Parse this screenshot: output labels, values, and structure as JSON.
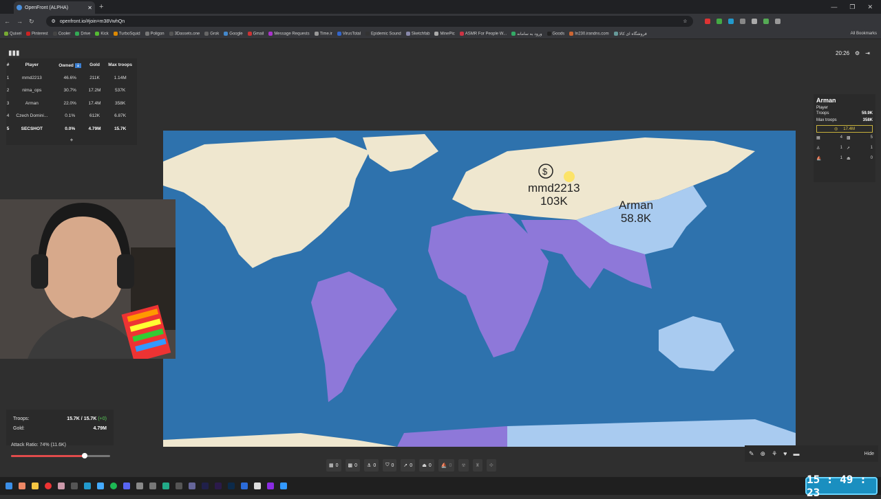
{
  "browser": {
    "tab_title": "OpenFront (ALPHA)",
    "url": "openfront.io/#join=m38VwhQn",
    "bookmarks": [
      "Quixel",
      "Pinterest",
      "Cooler",
      "Drive",
      "Kick",
      "TurboSquid",
      "Poligon",
      "3Dassets.one",
      "Grok",
      "Google",
      "Gmail",
      "Message Requests",
      "Time.ir",
      "VirusTotal",
      "Epidemic Sound",
      "Sketchfab",
      "MinePic",
      "ASMR For People W...",
      "ورود به سامانه",
      "Goods",
      "In230.irandns.com",
      "فروشگاه ای کالا"
    ],
    "all_bookmarks": "All Bookmarks"
  },
  "leaderboard": {
    "headers": [
      "#",
      "Player",
      "Owned",
      "Gold",
      "Max troops"
    ],
    "rows": [
      {
        "rank": "1",
        "player": "mmd2213",
        "owned": "46.6%",
        "gold": "211K",
        "max": "1.14M"
      },
      {
        "rank": "2",
        "player": "nima_ops",
        "owned": "30.7%",
        "gold": "17.2M",
        "max": "537K"
      },
      {
        "rank": "3",
        "player": "Arman",
        "owned": "22.0%",
        "gold": "17.4M",
        "max": "358K"
      },
      {
        "rank": "4",
        "player": "Czech Domini...",
        "owned": "0.1%",
        "gold": "612K",
        "max": "6.87K"
      },
      {
        "rank": "5",
        "player": "SECSHOT",
        "owned": "0.0%",
        "gold": "4.79M",
        "max": "15.7K"
      }
    ],
    "expand": "+"
  },
  "game_time": "20:26",
  "player_info": {
    "name": "Arman",
    "type": "Player",
    "troops_label": "Troops",
    "troops": "59.9K",
    "max_label": "Max troops",
    "max": "358K",
    "gold": "17.4M",
    "buildings": [
      {
        "icon": "city",
        "n": "4"
      },
      {
        "icon": "factory",
        "n": "5"
      },
      {
        "icon": "port",
        "n": "1"
      },
      {
        "icon": "missile",
        "n": "1"
      },
      {
        "icon": "warship",
        "n": "1"
      },
      {
        "icon": "silo",
        "n": "0"
      }
    ]
  },
  "map": {
    "labels": [
      {
        "name": "mmd2213",
        "troops": "103K"
      },
      {
        "name": "Arman",
        "troops": "58.8K"
      }
    ],
    "colors": {
      "ocean": "#2e72ad",
      "mmd2213": "#efe7cf",
      "nima_ops": "#8e78d9",
      "arman": "#a9cbf0"
    }
  },
  "stats": {
    "troops_label": "Troops:",
    "troops": "15.7K / 15.7K",
    "troops_delta": "(+0)",
    "gold_label": "Gold:",
    "gold": "4.79M",
    "attack_ratio": "Attack Ratio: 74% (11.6K)",
    "attack_value": 0.74
  },
  "build_bar": [
    {
      "k": "1",
      "n": "0"
    },
    {
      "k": "2",
      "n": "0"
    },
    {
      "k": "3",
      "n": "0"
    },
    {
      "k": "4",
      "n": "0"
    },
    {
      "k": "5",
      "n": "0"
    },
    {
      "k": "6",
      "n": "0"
    }
  ],
  "build_bar_dim": [
    "0"
  ],
  "hide_label": "Hide",
  "clock": "15 : 49 : 23"
}
